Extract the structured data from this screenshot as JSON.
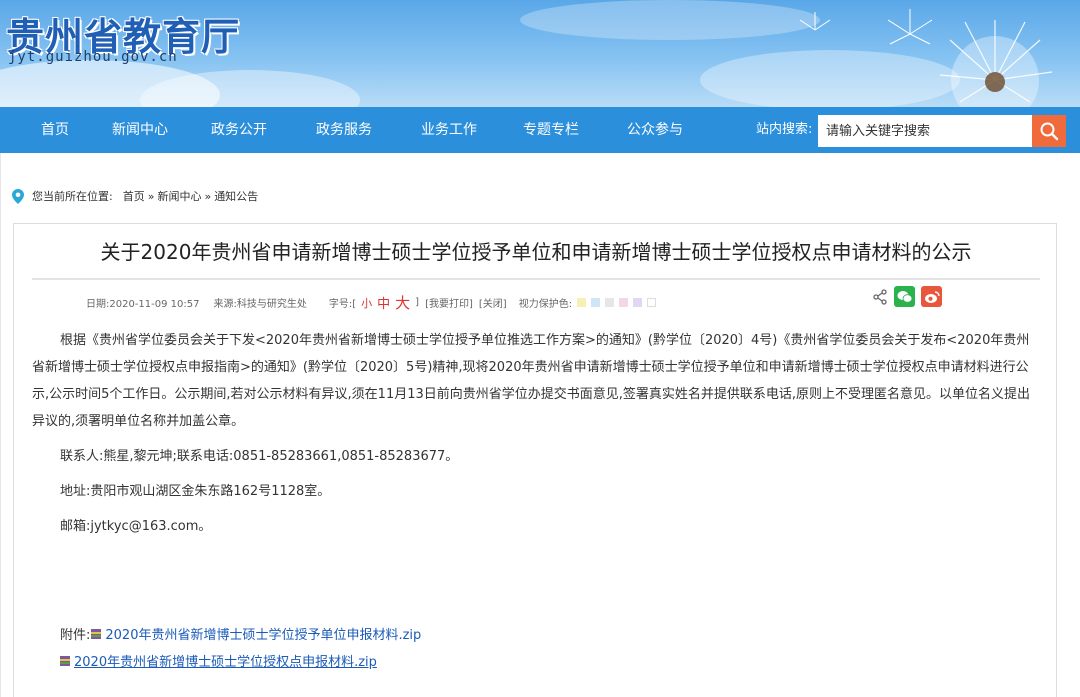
{
  "header": {
    "site_title": "贵州省教育厅",
    "site_domain": "jyt.guizhou.gov.cn"
  },
  "nav": {
    "items": [
      {
        "label": "首页"
      },
      {
        "label": "新闻中心"
      },
      {
        "label": "政务公开"
      },
      {
        "label": "政务服务"
      },
      {
        "label": "业务工作"
      },
      {
        "label": "专题专栏"
      },
      {
        "label": "公众参与"
      }
    ],
    "search_label": "站内搜索:",
    "search_placeholder": "请输入关键字搜索",
    "search_icon": "search-icon"
  },
  "breadcrumb": {
    "prefix": "您当前所在位置:",
    "items": [
      "首页",
      "新闻中心",
      "通知公告"
    ],
    "separator": "»"
  },
  "article": {
    "title": "关于2020年贵州省申请新增博士硕士学位授予单位和申请新增博士硕士学位授权点申请材料的公示",
    "meta": {
      "date": "日期:2020-11-09 10:57",
      "source": "来源:科技与研究生处",
      "font_label": "字号:[",
      "font_small": "小",
      "font_medium": "中",
      "font_large": "大",
      "font_close": "]",
      "print": "[我要打印]",
      "close": "[关闭]",
      "eye_label": "视力保护色:",
      "eye_colors": [
        "#f5f0b4",
        "#cfe6f6",
        "#e6e6e6",
        "#f3d7e6",
        "#e0d8f2",
        "#ffffff"
      ]
    },
    "share": {
      "icons": [
        "share-icon",
        "wechat-icon",
        "weibo-icon"
      ],
      "wechat_color": "#2bb24c",
      "weibo_color": "#e8563c"
    },
    "paragraph": "根据《贵州省学位委员会关于下发<2020年贵州省新增博士硕士学位授予单位推选工作方案>的通知》(黔学位〔2020〕4号)《贵州省学位委员会关于发布<2020年贵州省新增博士硕士学位授权点申报指南>的通知》(黔学位〔2020〕5号)精神,现将2020年贵州省申请新增博士硕士学位授予单位和申请新增博士硕士学位授权点申请材料进行公示,公示时间5个工作日。公示期间,若对公示材料有异议,须在11月13日前向贵州省学位办提交书面意见,签署真实姓名并提供联系电话,原则上不受理匿名意见。以单位名义提出异议的,须署明单位名称并加盖公章。",
    "contact": "联系人:熊星,黎元坤;联系电话:0851-85283661,0851-85283677。",
    "address": "地址:贵阳市观山湖区金朱东路162号1128室。",
    "email": "邮箱:jytkyc@163.com。",
    "attachments_label": "附件:",
    "attachments": [
      "2020年贵州省新增博士硕士学位授予单位申报材料.zip",
      "2020年贵州省新增博士硕士学位授权点申报材料.zip"
    ]
  },
  "colors": {
    "nav_bg": "#2c8fdc",
    "search_button": "#f06a3c",
    "link": "#1a5bb8",
    "accent_red": "#d33"
  }
}
